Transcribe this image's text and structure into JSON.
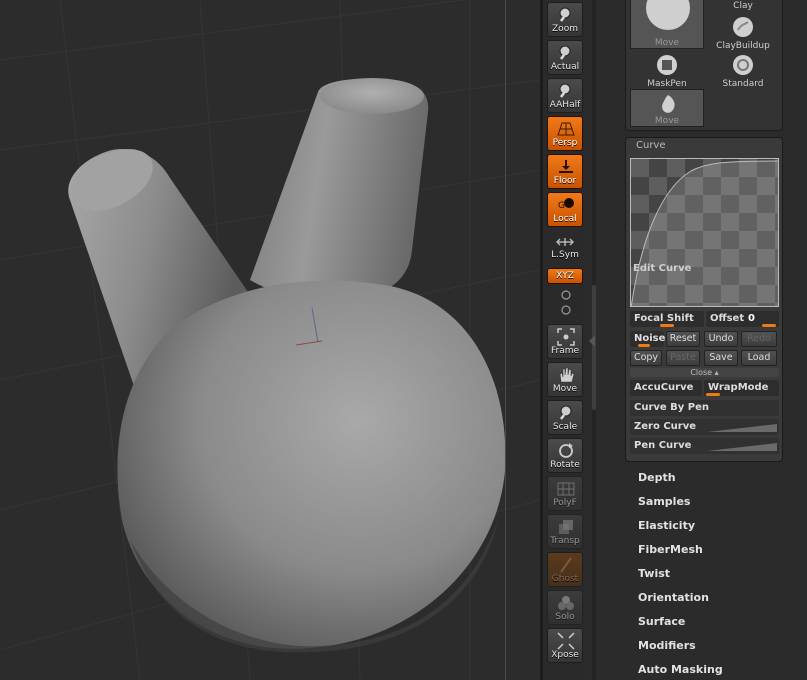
{
  "viewport": {
    "background": "#2c2c2c",
    "mesh_color": "#8a8a8a"
  },
  "shelf": {
    "buttons": [
      {
        "name": "zoom-button",
        "label": "Zoom",
        "icon": "magnifier-icon",
        "state": "normal"
      },
      {
        "name": "actual-button",
        "label": "Actual",
        "icon": "magnifier-icon",
        "state": "normal"
      },
      {
        "name": "aahalf-button",
        "label": "AAHalf",
        "icon": "magnifier-icon",
        "state": "normal"
      },
      {
        "name": "persp-button",
        "label": "Persp",
        "icon": "perspective-grid-icon",
        "state": "on"
      },
      {
        "name": "floor-button",
        "label": "Floor",
        "icon": "floor-icon",
        "state": "on"
      },
      {
        "name": "local-button",
        "label": "Local",
        "icon": "local-pivot-icon",
        "state": "on"
      },
      {
        "name": "lsym-button",
        "label": "L.Sym",
        "icon": "symmetry-arrows-icon",
        "state": "flat"
      },
      {
        "name": "xyz-button",
        "label": "XYZ",
        "icon": "xyz-rotation-icon",
        "state": "on"
      },
      {
        "name": "frame-button",
        "label": "Frame",
        "icon": "frame-icon",
        "state": "normal"
      },
      {
        "name": "move-button",
        "label": "Move",
        "icon": "hand-icon",
        "state": "normal"
      },
      {
        "name": "scale-button",
        "label": "Scale",
        "icon": "magnifier-icon",
        "state": "normal"
      },
      {
        "name": "rotate-button",
        "label": "Rotate",
        "icon": "rotate-icon",
        "state": "normal"
      },
      {
        "name": "polyf-button",
        "label": "PolyF",
        "icon": "polyframe-icon",
        "state": "dim"
      },
      {
        "name": "transp-button",
        "label": "Transp",
        "icon": "transparency-icon",
        "state": "dim"
      },
      {
        "name": "ghost-button",
        "label": "Ghost",
        "icon": "ghost-icon",
        "state": "ghost"
      },
      {
        "name": "solo-button",
        "label": "Solo",
        "icon": "solo-spheres-icon",
        "state": "dim"
      },
      {
        "name": "xpose-button",
        "label": "Xpose",
        "icon": "xpose-icon",
        "state": "normal"
      }
    ]
  },
  "brushes": {
    "items": [
      {
        "label": "Move",
        "selected": true
      },
      {
        "label": "Clay",
        "selected": false
      },
      {
        "label": "ClayBuildup",
        "selected": false
      },
      {
        "label": "MaskPen",
        "selected": false
      },
      {
        "label": "Standard",
        "selected": false
      },
      {
        "label": "Move",
        "selected": true
      }
    ]
  },
  "curve": {
    "title": "Curve",
    "edit_label": "Edit Curve",
    "focal_shift_label": "Focal Shift",
    "focal_shift_value": 0,
    "offset_label": "Offset",
    "offset_value": "0",
    "noise_label": "Noise",
    "reset": "Reset",
    "undo": "Undo",
    "redo": "Redo",
    "copy": "Copy",
    "paste": "Paste",
    "save": "Save",
    "load": "Load",
    "close": "Close",
    "accucurve": "AccuCurve",
    "wrapmode": "WrapMode",
    "curve_by_pen": "Curve By Pen",
    "zero_curve": "Zero Curve",
    "pen_curve": "Pen Curve"
  },
  "menu": {
    "items": [
      "Depth",
      "Samples",
      "Elasticity",
      "FiberMesh",
      "Twist",
      "Orientation",
      "Surface",
      "Modifiers",
      "Auto Masking"
    ]
  },
  "colors": {
    "accent": "#ef7a14",
    "panel": "#3a3a3a",
    "background": "#2a2a2a"
  }
}
